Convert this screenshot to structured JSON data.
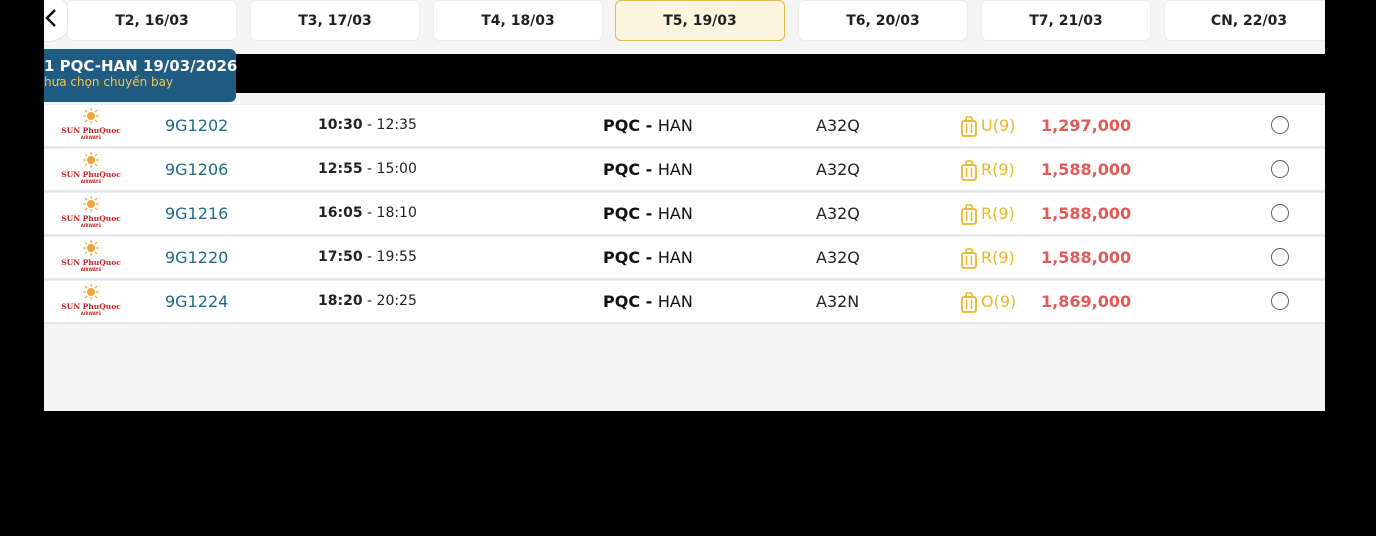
{
  "date_tabs": [
    {
      "label": "T2, 16/03",
      "active": false
    },
    {
      "label": "T3, 17/03",
      "active": false
    },
    {
      "label": "T4, 18/03",
      "active": false
    },
    {
      "label": "T5, 19/03",
      "active": true
    },
    {
      "label": "T6, 20/03",
      "active": false
    },
    {
      "label": "T7, 21/03",
      "active": false
    },
    {
      "label": "CN, 22/03",
      "active": false
    }
  ],
  "leg": {
    "title": "1 PQC-HAN 19/03/2026",
    "subtitle": "hưa chọn chuyến bay"
  },
  "airline": {
    "logo_text_top": "SUN PhuQuoc",
    "logo_text_bottom": "AIRWAYS"
  },
  "flights": [
    {
      "flight_no": "9G1202",
      "depart": "10:30",
      "arrive": " - 12:35",
      "origin": "PQC",
      "sep": " - ",
      "destination": "HAN",
      "aircraft": "A32Q",
      "fare_class": "U(9)",
      "price": "1,297,000"
    },
    {
      "flight_no": "9G1206",
      "depart": "12:55",
      "arrive": " - 15:00",
      "origin": "PQC",
      "sep": " - ",
      "destination": "HAN",
      "aircraft": "A32Q",
      "fare_class": "R(9)",
      "price": "1,588,000"
    },
    {
      "flight_no": "9G1216",
      "depart": "16:05",
      "arrive": " - 18:10",
      "origin": "PQC",
      "sep": " - ",
      "destination": "HAN",
      "aircraft": "A32Q",
      "fare_class": "R(9)",
      "price": "1,588,000"
    },
    {
      "flight_no": "9G1220",
      "depart": "17:50",
      "arrive": " - 19:55",
      "origin": "PQC",
      "sep": " - ",
      "destination": "HAN",
      "aircraft": "A32Q",
      "fare_class": "R(9)",
      "price": "1,588,000"
    },
    {
      "flight_no": "9G1224",
      "depart": "18:20",
      "arrive": " - 20:25",
      "origin": "PQC",
      "sep": " - ",
      "destination": "HAN",
      "aircraft": "A32N",
      "fare_class": "O(9)",
      "price": "1,869,000"
    }
  ],
  "colors": {
    "accent": "#1f5b82",
    "price": "#e05a5a",
    "fare": "#e8b82a",
    "active_tab": "#fdf5dd"
  }
}
